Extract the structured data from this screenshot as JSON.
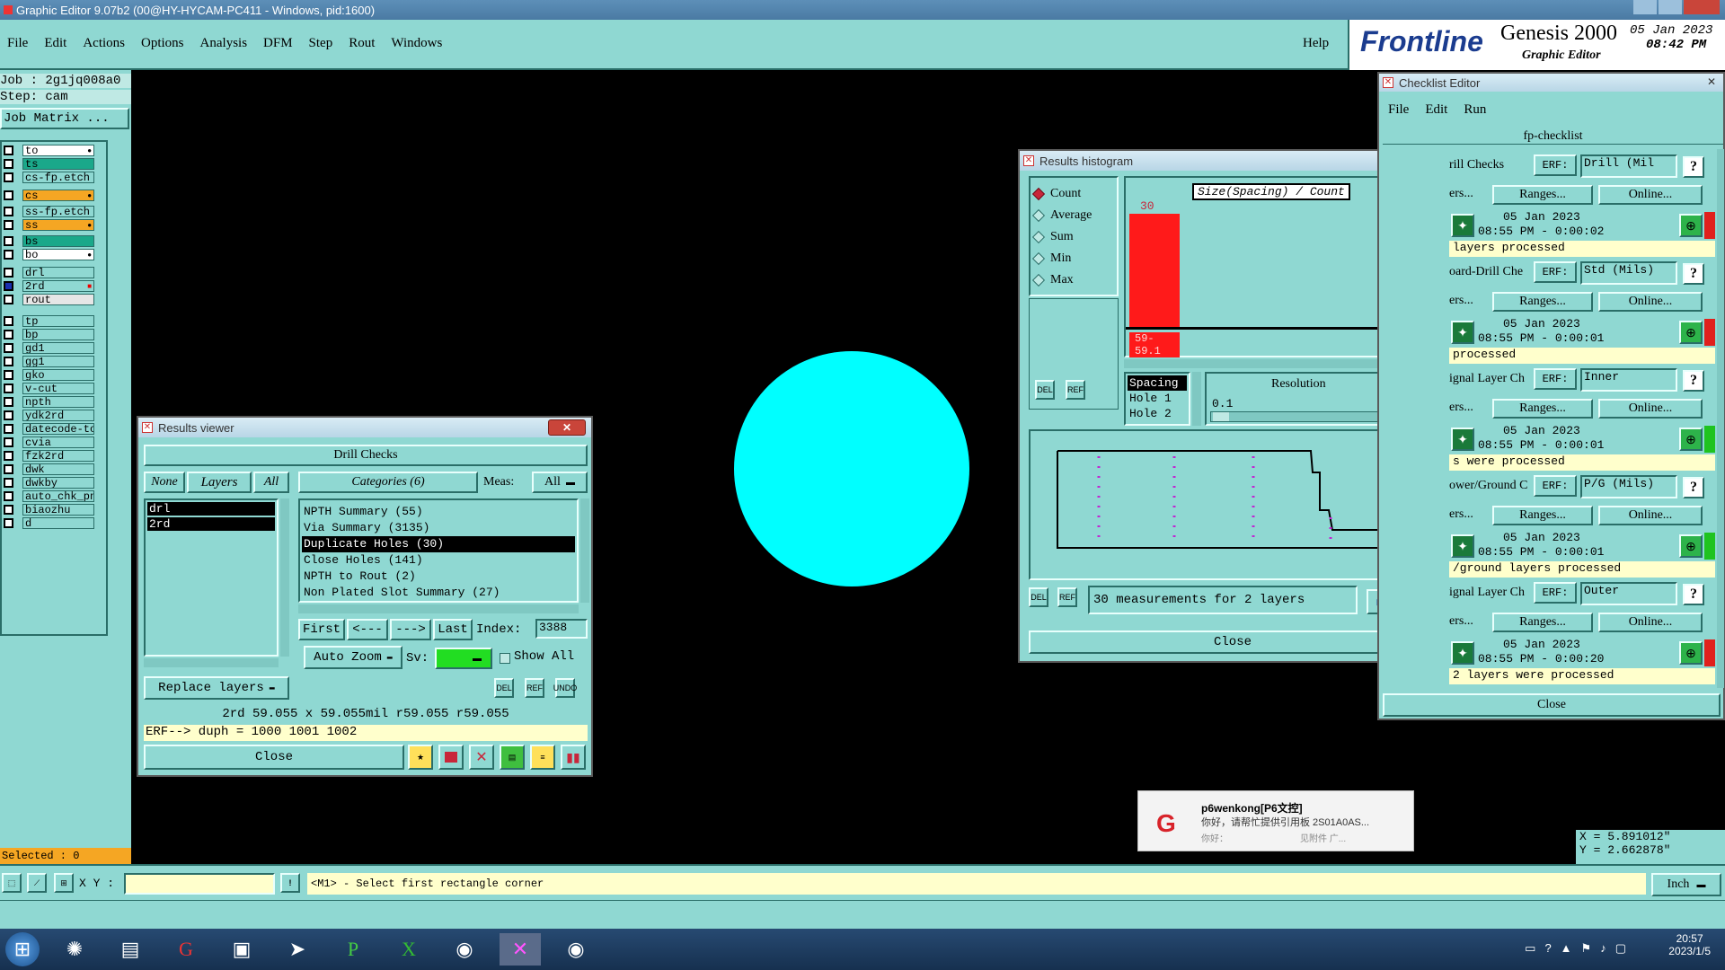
{
  "app_title": "Graphic Editor 9.07b2 (00@HY-HYCAM-PC411 - Windows, pid:1600)",
  "menu": [
    "File",
    "Edit",
    "Actions",
    "Options",
    "Analysis",
    "DFM",
    "Step",
    "Rout",
    "Windows"
  ],
  "help": "Help",
  "brand": {
    "logo": "Frontline",
    "product": "Genesis 2000",
    "subtitle": "Graphic Editor",
    "date": "05 Jan 2023",
    "time": "08:42 PM"
  },
  "job": {
    "job": "Job : 2g1jq008a0",
    "step": "Step: cam",
    "matrix": "Job Matrix ..."
  },
  "layers": [
    {
      "name": "to",
      "color": "#ffffff",
      "mark": "●"
    },
    {
      "name": "ts",
      "color": "#1aa88a",
      "mark": ""
    },
    {
      "name": "cs-fp.etch",
      "color": "#8fd8d2",
      "mark": ""
    },
    {
      "name": "cs",
      "color": "#f5a623",
      "mark": "●"
    },
    {
      "name": "ss-fp.etch",
      "color": "#8fd8d2",
      "mark": ""
    },
    {
      "name": "ss",
      "color": "#f5a623",
      "mark": "●"
    },
    {
      "name": "bs",
      "color": "#1aa88a",
      "mark": ""
    },
    {
      "name": "bo",
      "color": "#ffffff",
      "mark": "●"
    },
    {
      "name": "drl",
      "color": "#8fd8d2",
      "mark": ""
    },
    {
      "name": "2rd",
      "color": "#8fd8d2",
      "mark": "■"
    },
    {
      "name": "rout",
      "color": "#e6e6e6",
      "mark": ""
    },
    {
      "name": "tp",
      "color": "#8fd8d2",
      "mark": ""
    },
    {
      "name": "bp",
      "color": "#8fd8d2",
      "mark": ""
    },
    {
      "name": "gd1",
      "color": "#8fd8d2",
      "mark": ""
    },
    {
      "name": "gg1",
      "color": "#8fd8d2",
      "mark": ""
    },
    {
      "name": "gko",
      "color": "#8fd8d2",
      "mark": ""
    },
    {
      "name": "v-cut",
      "color": "#8fd8d2",
      "mark": ""
    },
    {
      "name": "npth",
      "color": "#8fd8d2",
      "mark": ""
    },
    {
      "name": "ydk2rd",
      "color": "#8fd8d2",
      "mark": ""
    },
    {
      "name": "datecode-to",
      "color": "#8fd8d2",
      "mark": ""
    },
    {
      "name": "cvia",
      "color": "#8fd8d2",
      "mark": ""
    },
    {
      "name": "fzk2rd",
      "color": "#8fd8d2",
      "mark": ""
    },
    {
      "name": "dwk",
      "color": "#8fd8d2",
      "mark": ""
    },
    {
      "name": "dwkby",
      "color": "#8fd8d2",
      "mark": ""
    },
    {
      "name": "auto_chk_pn",
      "color": "#8fd8d2",
      "mark": ""
    },
    {
      "name": "biaozhu",
      "color": "#8fd8d2",
      "mark": ""
    },
    {
      "name": "d",
      "color": "#8fd8d2",
      "mark": ""
    }
  ],
  "selected": "Selected : 0",
  "results_viewer": {
    "title": "Results viewer",
    "header": "Drill Checks",
    "none": "None",
    "layers_btn": "Layers",
    "all": "All",
    "categories": "Categories (6)",
    "meas_label": "Meas:",
    "meas_value": "All",
    "layer_list": [
      "drl",
      "2rd"
    ],
    "cat_list": [
      "NPTH Summary (55)",
      "Via Summary (3135)",
      "Duplicate Holes (30)",
      "Close Holes (141)",
      "NPTH to Rout (2)",
      "Non Plated Slot Summary (27)"
    ],
    "first": "First",
    "prev": "<---",
    "next": "--->",
    "last": "Last",
    "index_label": "Index:",
    "index_value": "3388",
    "auto_zoom": "Auto Zoom",
    "sv": "Sv:",
    "show_all": "Show All",
    "replace_layers": "Replace layers",
    "del": "DEL",
    "ref": "REF",
    "undo": "UNDO",
    "status1": "2rd 59.055 x 59.055mil   r59.055   r59.055",
    "status2": "ERF--> duph = 1000 1001 1002",
    "close": "Close"
  },
  "histogram": {
    "title": "Results histogram",
    "modes": [
      "Count",
      "Average",
      "Sum",
      "Min",
      "Max"
    ],
    "chart_title": "Size(Spacing) / Count",
    "bar_value": "30",
    "bar_label": "59-\n59.1",
    "list": [
      "Spacing",
      "Hole 1",
      "Hole 2"
    ],
    "resolution_label": "Resolution",
    "resolution_value": "0.1",
    "status": "30 measurements for 2 layers",
    "close": "Close"
  },
  "checklist": {
    "title": "Checklist Editor",
    "menu": [
      "File",
      "Edit",
      "Run"
    ],
    "name": "fp-checklist",
    "rows": [
      {
        "name": "rill Checks",
        "erf": "Drill (Mil",
        "date": "05 Jan 2023",
        "time": "08:55 PM - 0:00:02",
        "msg": "layers processed",
        "status": "#e0201c"
      },
      {
        "name": "oard-Drill Che",
        "erf": "Std (Mils)",
        "date": "05 Jan 2023",
        "time": "08:55 PM - 0:00:01",
        "msg": "processed",
        "status": "#e0201c"
      },
      {
        "name": "ignal Layer Ch",
        "erf": "Inner",
        "date": "05 Jan 2023",
        "time": "08:55 PM - 0:00:01",
        "msg": "s were processed",
        "status": "#1fc31f"
      },
      {
        "name": "ower/Ground C",
        "erf": "P/G (Mils)",
        "date": "05 Jan 2023",
        "time": "08:55 PM - 0:00:01",
        "msg": "/ground layers processed",
        "status": "#1fc31f"
      },
      {
        "name": "ignal Layer Ch",
        "erf": "Outer",
        "date": "05 Jan 2023",
        "time": "08:55 PM - 0:00:20",
        "msg": "2 layers were processed",
        "status": "#e0201c"
      }
    ],
    "erf_label": "ERF:",
    "ranges": "Ranges...",
    "online": "Online...",
    "ers": "ers...",
    "close": "Close"
  },
  "coords": {
    "x": "X = 5.891012\"",
    "y": "Y = 2.662878\""
  },
  "bottom": {
    "xy_label": "X Y :",
    "prompt": "<M1> - Select first rectangle corner",
    "units": "Inch"
  },
  "notification": {
    "title": "p6wenkong[P6文控]",
    "line1": "你好，请帮忙提供引用板 2S01A0AS...",
    "line2": "你好：",
    "line3": "见附件   广..."
  },
  "clock": {
    "time": "20:57",
    "date": "2023/1/5"
  }
}
